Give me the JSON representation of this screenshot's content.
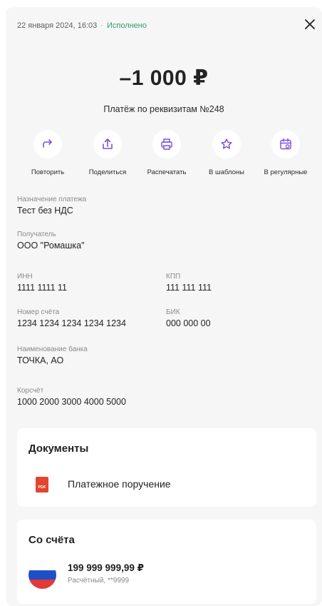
{
  "header": {
    "datetime": "22 января 2024, 16:03",
    "separator": "·",
    "status": "Исполнено"
  },
  "payment": {
    "amount": "–1 000 ₽",
    "title": "Платёж по реквизитам №248"
  },
  "actions": [
    {
      "label": "Повторить",
      "icon": "repeat-icon"
    },
    {
      "label": "Поделиться",
      "icon": "share-icon"
    },
    {
      "label": "Распечатать",
      "icon": "print-icon"
    },
    {
      "label": "В шаблоны",
      "icon": "star-icon"
    },
    {
      "label": "В регулярные",
      "icon": "calendar-repeat-icon"
    }
  ],
  "details": {
    "purpose": {
      "label": "Назначение платежа",
      "value": "Тест без НДС"
    },
    "recipient": {
      "label": "Получатель",
      "value": "ООО \"Ромашка\""
    },
    "inn": {
      "label": "ИНН",
      "value": "1111 1111 11"
    },
    "kpp": {
      "label": "КПП",
      "value": "111 111 111"
    },
    "account": {
      "label": "Номер счёта",
      "value": "1234 1234 1234 1234 1234"
    },
    "bik": {
      "label": "БИК",
      "value": "000 000 00"
    },
    "bank": {
      "label": "Наименование банка",
      "value": "ТОЧКА, АО"
    },
    "corr": {
      "label": "Корсчёт",
      "value": "1000 2000 3000 4000 5000"
    }
  },
  "documents": {
    "title": "Документы",
    "items": [
      {
        "name": "Платежное поручение",
        "badge": "PDF"
      }
    ]
  },
  "source": {
    "title": "Со счёта",
    "amount": "199 999 999,99 ₽",
    "subtitle": "Расчётный, **9999"
  },
  "colors": {
    "accent": "#7b52e0",
    "status": "#2f9e6a",
    "pdf": "#e2442f"
  }
}
